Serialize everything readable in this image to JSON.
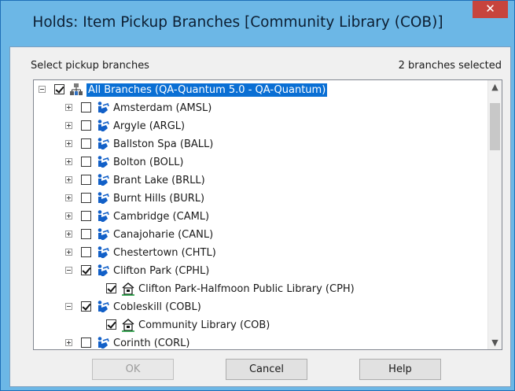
{
  "window": {
    "title": "Holds: Item Pickup Branches [Community Library  (COB)]",
    "close_symbol": "✕"
  },
  "header": {
    "left_label": "Select pickup branches",
    "right_label": "2 branches selected"
  },
  "tree": {
    "items": [
      {
        "label": "All Branches (QA-Quantum 5.0 - QA-Quantum)",
        "level": 0,
        "expander": "minus",
        "checked": true,
        "icon": "network-icon",
        "selected": true
      },
      {
        "label": "Amsterdam  (AMSL)",
        "level": 1,
        "expander": "plus",
        "checked": false,
        "icon": "library-org-icon"
      },
      {
        "label": "Argyle (ARGL)",
        "level": 1,
        "expander": "plus",
        "checked": false,
        "icon": "library-org-icon"
      },
      {
        "label": "Ballston Spa (BALL)",
        "level": 1,
        "expander": "plus",
        "checked": false,
        "icon": "library-org-icon"
      },
      {
        "label": "Bolton (BOLL)",
        "level": 1,
        "expander": "plus",
        "checked": false,
        "icon": "library-org-icon"
      },
      {
        "label": "Brant Lake (BRLL)",
        "level": 1,
        "expander": "plus",
        "checked": false,
        "icon": "library-org-icon"
      },
      {
        "label": "Burnt Hills (BURL)",
        "level": 1,
        "expander": "plus",
        "checked": false,
        "icon": "library-org-icon"
      },
      {
        "label": "Cambridge (CAML)",
        "level": 1,
        "expander": "plus",
        "checked": false,
        "icon": "library-org-icon"
      },
      {
        "label": "Canajoharie (CANL)",
        "level": 1,
        "expander": "plus",
        "checked": false,
        "icon": "library-org-icon"
      },
      {
        "label": "Chestertown (CHTL)",
        "level": 1,
        "expander": "plus",
        "checked": false,
        "icon": "library-org-icon"
      },
      {
        "label": "Clifton Park (CPHL)",
        "level": 1,
        "expander": "minus",
        "checked": true,
        "icon": "library-org-icon"
      },
      {
        "label": "Clifton Park-Halfmoon Public Library (CPH)",
        "level": 2,
        "expander": "none",
        "checked": true,
        "icon": "branch-building-icon"
      },
      {
        "label": "Cobleskill (COBL)",
        "level": 1,
        "expander": "minus",
        "checked": true,
        "icon": "library-org-icon"
      },
      {
        "label": "Community Library  (COB)",
        "level": 2,
        "expander": "none",
        "checked": true,
        "icon": "branch-building-icon"
      },
      {
        "label": "Corinth (CORL)",
        "level": 1,
        "expander": "plus",
        "checked": false,
        "icon": "library-org-icon"
      }
    ]
  },
  "buttons": {
    "ok": "OK",
    "cancel": "Cancel",
    "help": "Help"
  },
  "colors": {
    "titlebar": "#6cb7e6",
    "selection": "#0a6fd4",
    "close": "#c7443d"
  }
}
